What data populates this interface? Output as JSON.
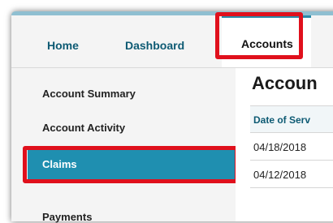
{
  "nav": {
    "home": "Home",
    "dashboard": "Dashboard",
    "accounts": "Accounts"
  },
  "sidebar": {
    "items": [
      {
        "label": "Account Summary"
      },
      {
        "label": "Account Activity"
      },
      {
        "label": "Claims"
      },
      {
        "label": "Payments"
      }
    ]
  },
  "main": {
    "title": "Accoun",
    "table": {
      "header": "Date of Serv",
      "rows": [
        "04/18/2018",
        "04/12/2018"
      ]
    }
  },
  "colors": {
    "accent": "#1f8fb0",
    "highlight_box": "#e0101c",
    "nav_text": "#0d5a73"
  }
}
